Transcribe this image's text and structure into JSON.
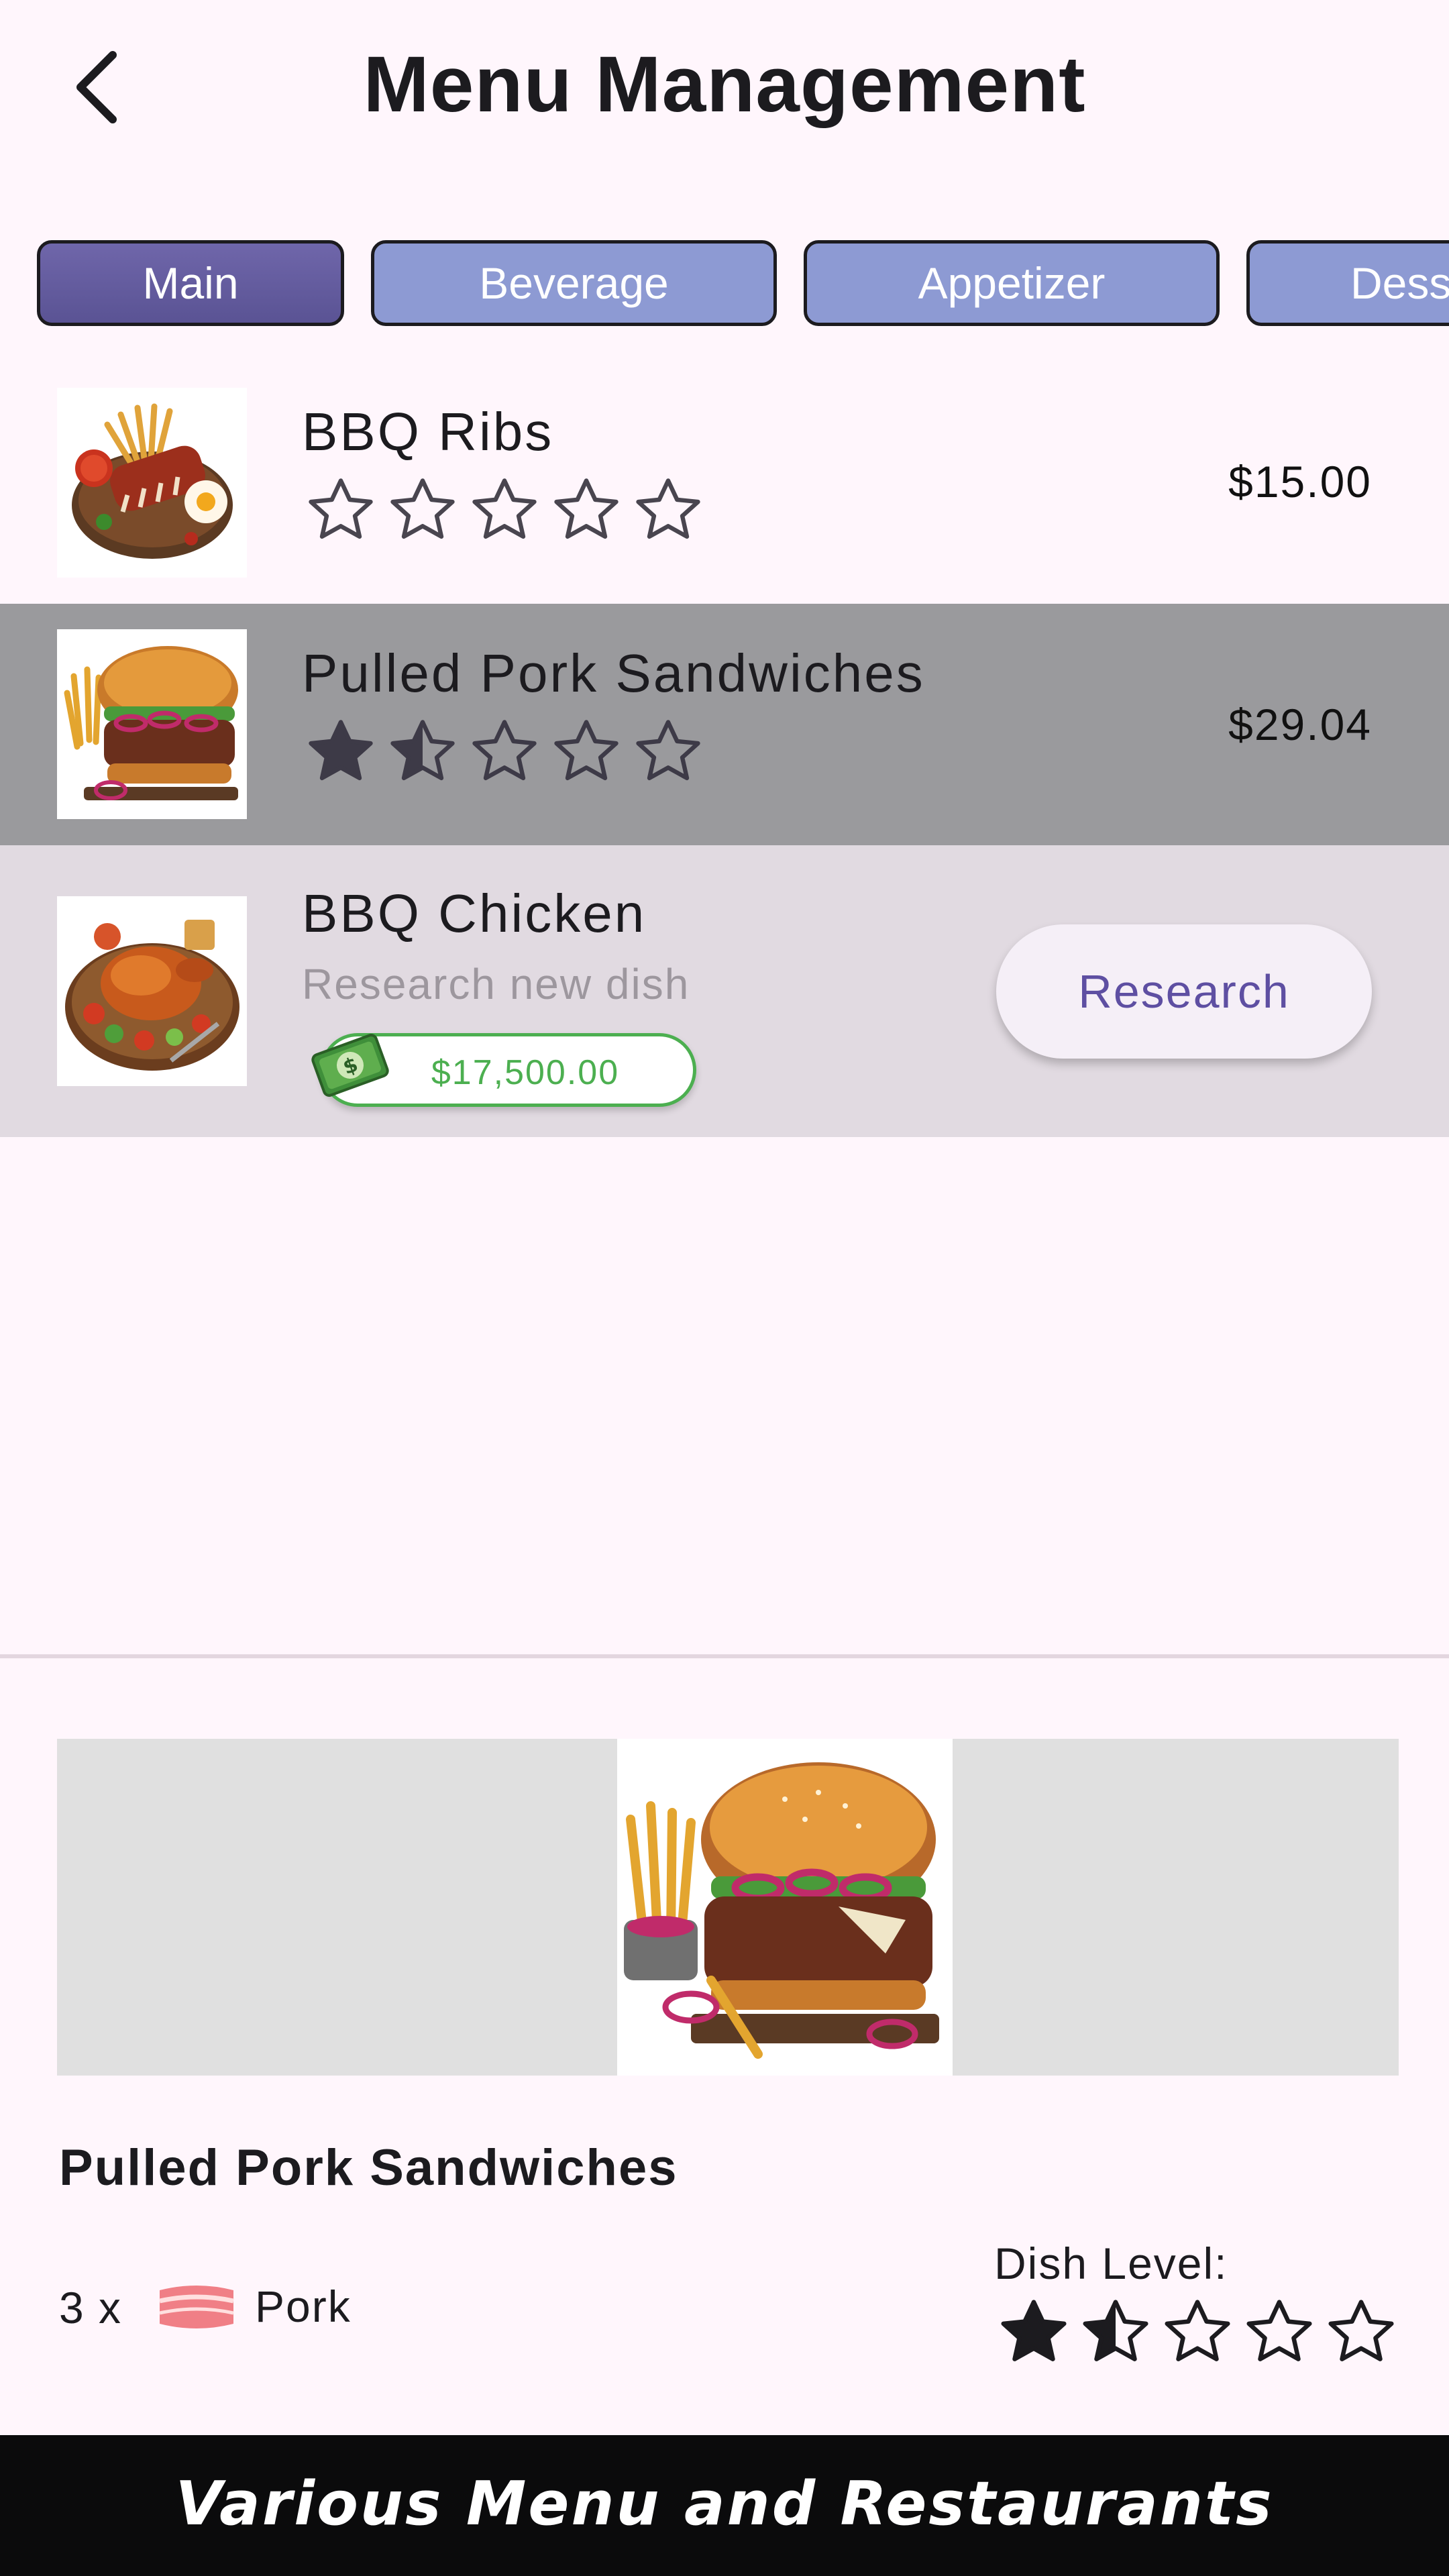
{
  "header": {
    "title": "Menu Management",
    "back_icon": "chevron-left-icon"
  },
  "tabs": [
    {
      "label": "Main",
      "active": true
    },
    {
      "label": "Beverage",
      "active": false
    },
    {
      "label": "Appetizer",
      "active": false
    },
    {
      "label": "Dess",
      "active": false
    }
  ],
  "dishes": [
    {
      "name": "BBQ Ribs",
      "rating": 0,
      "price": "$15.00",
      "selected": false,
      "image_icon": "bbq-ribs-image"
    },
    {
      "name": "Pulled Pork Sandwiches",
      "rating": 1.5,
      "price": "$29.04",
      "selected": true,
      "image_icon": "pulled-pork-image"
    },
    {
      "name": "BBQ Chicken",
      "subtitle": "Research new dish",
      "cost": "$17,500.00",
      "action_label": "Research",
      "locked": true,
      "image_icon": "bbq-chicken-image"
    }
  ],
  "detail": {
    "title": "Pulled Pork Sandwiches",
    "ingredient_qty": "3 x",
    "ingredient_name": "Pork",
    "ingredient_icon": "pork-icon",
    "level_label": "Dish Level:",
    "level_rating": 1.5
  },
  "footer": {
    "text": "Various Menu and Restaurants"
  },
  "colors": {
    "background": "#fff6fc",
    "tab_active": "#5a5394",
    "tab_inactive": "#8d9ad3",
    "selected_row": "#9a9a9d",
    "locked_row": "#e1dae1",
    "accent": "#5e4fa2",
    "cost_green": "#4caf50",
    "footer_bg": "#0b0b0c"
  }
}
